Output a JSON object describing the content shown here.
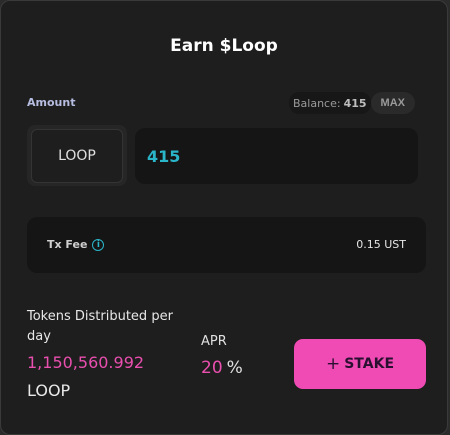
{
  "title": "Earn $Loop",
  "amount": {
    "label": "Amount",
    "balance_label": "Balance:",
    "balance_value": "415",
    "max_label": "MAX",
    "token": "LOOP",
    "input_value": "415"
  },
  "fee": {
    "label": "Tx Fee",
    "value": "0.15 UST"
  },
  "stats": {
    "distributed_label": "Tokens Distributed per day",
    "distributed_value": "1,150,560.992",
    "distributed_unit": "LOOP",
    "apr_label": "APR",
    "apr_value": "20",
    "apr_unit": "%"
  },
  "stake": {
    "label": "STAKE"
  },
  "colors": {
    "accent_pink": "#f04bb4",
    "accent_cyan": "#2bb5c9",
    "card_bg": "#1e1e1e"
  }
}
